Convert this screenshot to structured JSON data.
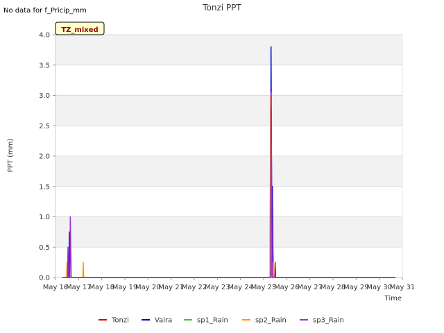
{
  "no_data_note": "No data for f_Pricip_mm",
  "badge_label": "TZ_mixed",
  "chart_data": {
    "type": "line",
    "title": "Tonzi PPT",
    "xlabel": "Time",
    "ylabel": "PPT (mm)",
    "xlim": [
      16,
      31
    ],
    "ylim": [
      0,
      4.0
    ],
    "x_ticks": [
      16,
      17,
      18,
      19,
      20,
      21,
      22,
      23,
      24,
      25,
      26,
      27,
      28,
      29,
      30,
      31
    ],
    "x_tick_labels": [
      "May 16",
      "May 17",
      "May 18",
      "May 19",
      "May 20",
      "May 21",
      "May 22",
      "May 23",
      "May 24",
      "May 25",
      "May 26",
      "May 27",
      "May 28",
      "May 29",
      "May 30",
      "May 31"
    ],
    "y_ticks": [
      0.0,
      0.5,
      1.0,
      1.5,
      2.0,
      2.5,
      3.0,
      3.5,
      4.0
    ],
    "y_tick_labels": [
      "0.0",
      "0.5",
      "1.0",
      "1.5",
      "2.0",
      "2.5",
      "3.0",
      "3.5",
      "4.0"
    ],
    "grid": true,
    "legend_position": "bottom",
    "series": [
      {
        "name": "Tonzi",
        "color": "#dd0000",
        "points": [
          [
            16.3,
            0
          ],
          [
            25.28,
            0
          ],
          [
            25.3,
            2.8
          ],
          [
            25.32,
            0
          ],
          [
            25.36,
            0
          ],
          [
            25.38,
            1.5
          ],
          [
            25.4,
            0
          ],
          [
            25.48,
            0
          ],
          [
            25.5,
            0.25
          ],
          [
            25.52,
            0
          ],
          [
            30.7,
            0
          ]
        ]
      },
      {
        "name": "Vaira",
        "color": "#0000cc",
        "points": [
          [
            16.3,
            0
          ],
          [
            16.58,
            0
          ],
          [
            16.6,
            0.75
          ],
          [
            16.62,
            0
          ],
          [
            25.3,
            0
          ],
          [
            25.32,
            3.8
          ],
          [
            25.34,
            2.0
          ],
          [
            25.36,
            0.5
          ],
          [
            25.38,
            1.5
          ],
          [
            25.4,
            0.5
          ],
          [
            25.42,
            0
          ],
          [
            30.7,
            0
          ]
        ]
      },
      {
        "name": "sp1_Rain",
        "color": "#33cc33",
        "points": [
          [
            16.3,
            0
          ],
          [
            30.7,
            0
          ]
        ]
      },
      {
        "name": "sp2_Rain",
        "color": "#ff9900",
        "points": [
          [
            16.3,
            0
          ],
          [
            16.48,
            0
          ],
          [
            16.5,
            0.25
          ],
          [
            16.52,
            0
          ],
          [
            17.18,
            0
          ],
          [
            17.2,
            0.25
          ],
          [
            17.22,
            0
          ],
          [
            25.28,
            0
          ],
          [
            25.3,
            3.0
          ],
          [
            25.32,
            0
          ],
          [
            25.38,
            0
          ],
          [
            25.4,
            0.25
          ],
          [
            25.42,
            0
          ],
          [
            30.7,
            0
          ]
        ]
      },
      {
        "name": "sp3_Rain",
        "color": "#9933cc",
        "points": [
          [
            16.3,
            0
          ],
          [
            16.52,
            0
          ],
          [
            16.54,
            0.5
          ],
          [
            16.56,
            0
          ],
          [
            16.62,
            0
          ],
          [
            16.64,
            1.0
          ],
          [
            16.66,
            0.5
          ],
          [
            16.68,
            0
          ],
          [
            25.3,
            0
          ],
          [
            25.32,
            3.05
          ],
          [
            25.34,
            2.0
          ],
          [
            25.36,
            1.0
          ],
          [
            25.38,
            0
          ],
          [
            30.7,
            0
          ]
        ]
      }
    ]
  }
}
